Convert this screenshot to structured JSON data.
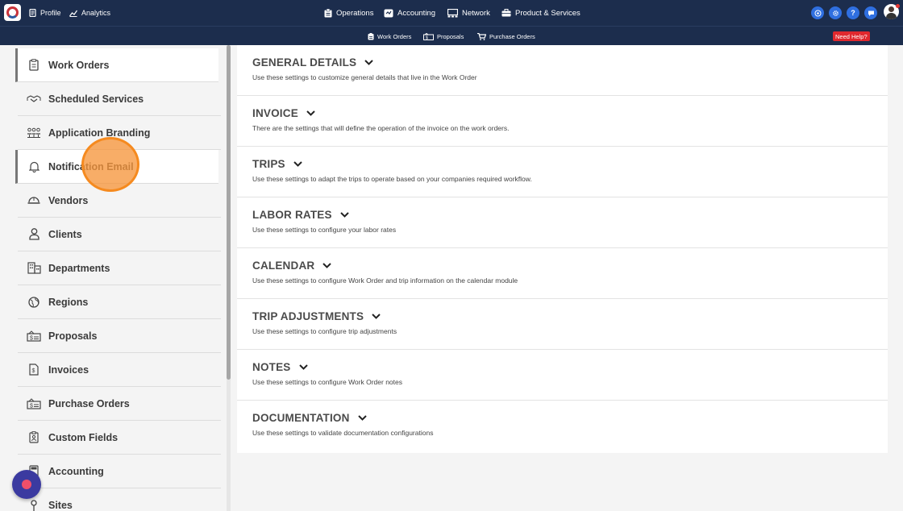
{
  "topbar": {
    "left": [
      {
        "label": "Profile",
        "icon": "profile-icon"
      },
      {
        "label": "Analytics",
        "icon": "analytics-icon"
      }
    ],
    "center": [
      {
        "label": "Operations",
        "icon": "clipboard-icon"
      },
      {
        "label": "Accounting",
        "icon": "accounting-icon"
      },
      {
        "label": "Network",
        "icon": "network-icon"
      },
      {
        "label": "Product & Services",
        "icon": "briefcase-icon"
      }
    ],
    "right_icons": [
      "target-icon",
      "gear-icon",
      "question-icon",
      "chat-icon",
      "avatar"
    ],
    "accent": "#2f6fe0"
  },
  "subbar": {
    "items": [
      {
        "label": "Work Orders",
        "icon": "clipboard-icon"
      },
      {
        "label": "Proposals",
        "icon": "proposal-icon"
      },
      {
        "label": "Purchase Orders",
        "icon": "cart-icon"
      }
    ],
    "help_label": "Need Help?"
  },
  "sidebar": {
    "items": [
      {
        "label": "Work Orders",
        "icon": "clipboard-icon",
        "active": true
      },
      {
        "label": "Scheduled Services",
        "icon": "handshake-icon"
      },
      {
        "label": "Application Branding",
        "icon": "people-group-icon"
      },
      {
        "label": "Notification Email",
        "icon": "bell-icon",
        "active": true
      },
      {
        "label": "Vendors",
        "icon": "hardhat-icon"
      },
      {
        "label": "Clients",
        "icon": "person-icon"
      },
      {
        "label": "Departments",
        "icon": "building-icon"
      },
      {
        "label": "Regions",
        "icon": "globe-icon"
      },
      {
        "label": "Proposals",
        "icon": "proposal-icon"
      },
      {
        "label": "Invoices",
        "icon": "invoice-icon"
      },
      {
        "label": "Purchase Orders",
        "icon": "purchase-order-icon"
      },
      {
        "label": "Custom Fields",
        "icon": "id-badge-icon"
      },
      {
        "label": "Accounting",
        "icon": "calculator-icon"
      },
      {
        "label": "Sites",
        "icon": "map-pin-icon"
      }
    ]
  },
  "sections": [
    {
      "title": "GENERAL DETAILS",
      "desc": "Use these settings to customize general details that live in the Work Order"
    },
    {
      "title": "INVOICE",
      "desc": "There are the settings that will define the operation of the invoice on the work orders."
    },
    {
      "title": "TRIPS",
      "desc": "Use these settings to adapt the trips to operate based on your companies required workflow."
    },
    {
      "title": "LABOR RATES",
      "desc": "Use these settings to configure your labor rates"
    },
    {
      "title": "CALENDAR",
      "desc": "Use these settings to configure Work Order and trip information on the calendar module"
    },
    {
      "title": "TRIP ADJUSTMENTS",
      "desc": "Use these settings to configure trip adjustments"
    },
    {
      "title": "NOTES",
      "desc": "Use these settings to configure Work Order notes"
    },
    {
      "title": "DOCUMENTATION",
      "desc": "Use these settings to validate documentation configurations"
    }
  ]
}
